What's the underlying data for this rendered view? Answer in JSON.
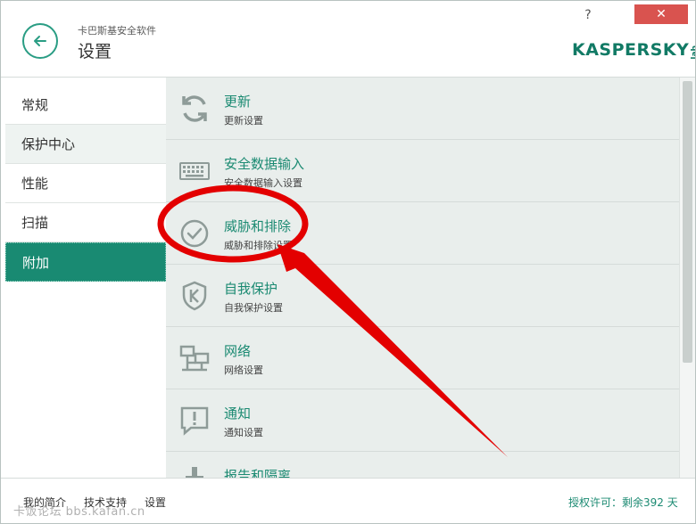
{
  "header": {
    "app_name": "卡巴斯基安全软件",
    "title": "设置",
    "help": "?",
    "close": "✕",
    "logo": "KASPERSKY",
    "logo_sub": "lab"
  },
  "sidebar": {
    "items": [
      {
        "label": "常规"
      },
      {
        "label": "保护中心"
      },
      {
        "label": "性能"
      },
      {
        "label": "扫描"
      },
      {
        "label": "附加"
      }
    ]
  },
  "content": {
    "rows": [
      {
        "title": "更新",
        "subtitle": "更新设置",
        "icon": "update-icon"
      },
      {
        "title": "安全数据输入",
        "subtitle": "安全数据输入设置",
        "icon": "keyboard-icon"
      },
      {
        "title": "威胁和排除",
        "subtitle": "威胁和排除设置",
        "icon": "check-circle-icon"
      },
      {
        "title": "自我保护",
        "subtitle": "自我保护设置",
        "icon": "shield-icon"
      },
      {
        "title": "网络",
        "subtitle": "网络设置",
        "icon": "network-icon"
      },
      {
        "title": "通知",
        "subtitle": "通知设置",
        "icon": "notification-icon"
      },
      {
        "title": "报告和隔离",
        "subtitle": "",
        "icon": "report-icon"
      }
    ]
  },
  "footer": {
    "links": [
      "我的简介",
      "技术支持",
      "设置"
    ],
    "license": "授权许可：剩余392 天",
    "watermark": "卡饭论坛 bbs.kafan.cn"
  },
  "colors": {
    "accent": "#198a72",
    "annotation": "#e30000"
  }
}
